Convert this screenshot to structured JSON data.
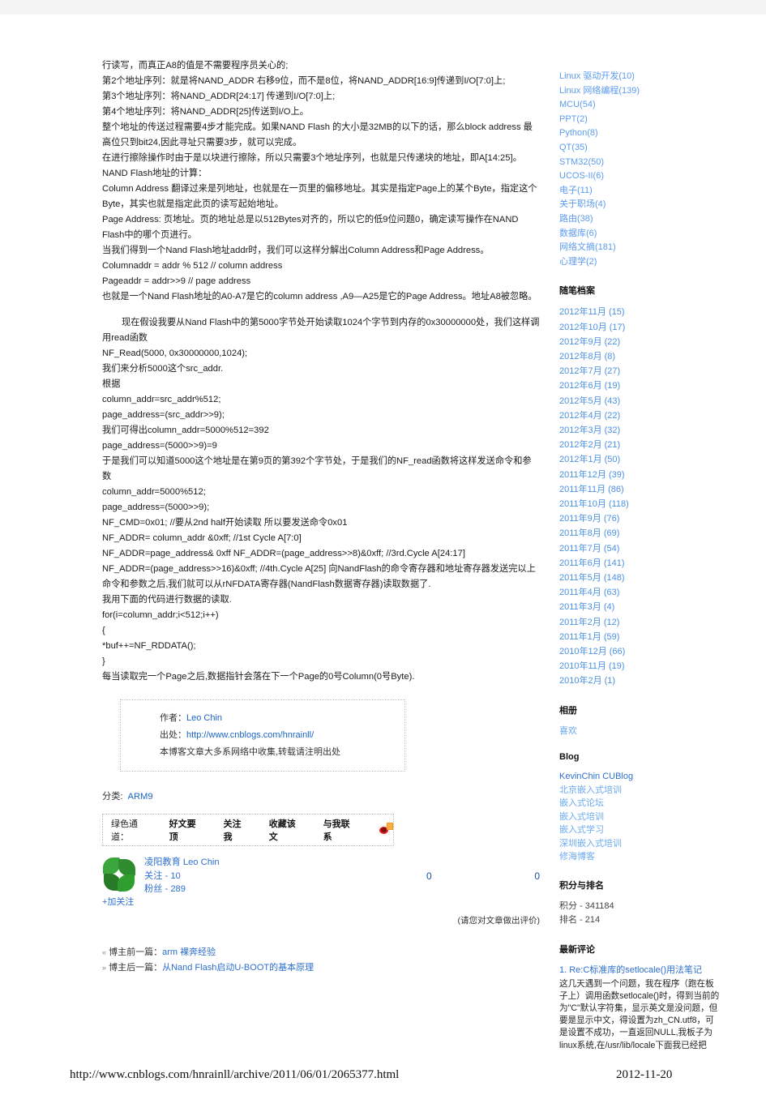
{
  "article": {
    "paragraphs": [
      "行读写，而真正A8的值是不需要程序员关心的;",
      "第2个地址序列：就是将NAND_ADDR 右移9位，而不是8位，将NAND_ADDR[16:9]传递到I/O[7:0]上;",
      "第3个地址序列：将NAND_ADDR[24:17] 传递到I/O[7:0]上;",
      "第4个地址序列：将NAND_ADDR[25]传送到I/O上。",
      "整个地址的传送过程需要4步才能完成。如果NAND Flash 的大小是32MB的以下的话，那么block address 最高位只到bit24,因此寻址只需要3步，就可以完成。",
      "在进行擦除操作时由于是以块进行擦除，所以只需要3个地址序列，也就是只传递块的地址，即A[14:25]。",
      "NAND Flash地址的计算：",
      "Column Address 翻译过来是列地址，也就是在一页里的偏移地址。其实是指定Page上的某个Byte，指定这个Byte，其实也就是指定此页的读写起始地址。",
      "Page Address: 页地址。页的地址总是以512Bytes对齐的，所以它的低9位问题0，确定读写操作在NAND Flash中的哪个页进行。",
      "当我们得到一个Nand Flash地址addr时，我们可以这样分解出Column Address和Page Address。",
      "Columnaddr = addr % 512 // column address",
      "Pageaddr = addr>>9 // page address",
      "也就是一个Nand Flash地址的A0-A7是它的column address ,A9—A25是它的Page Address。地址A8被忽略。"
    ],
    "paragraphs2": [
      "现在假设我要从Nand Flash中的第5000字节处开始读取1024个字节到内存的0x30000000处，我们这样调用read函数",
      "NF_Read(5000, 0x30000000,1024);",
      "我们来分析5000这个src_addr.",
      "根据",
      "column_addr=src_addr%512;",
      "page_address=(src_addr>>9);",
      "我们可得出column_addr=5000%512=392",
      "page_address=(5000>>9)=9",
      "于是我们可以知道5000这个地址是在第9页的第392个字节处，于是我们的NF_read函数将这样发送命令和参数",
      "column_addr=5000%512;",
      "page_address=(5000>>9);",
      "NF_CMD=0x01; //要从2nd half开始读取 所以要发送命令0x01",
      "NF_ADDR= column_addr &0xff; //1st Cycle A[7:0]",
      "NF_ADDR=page_address& 0xff NF_ADDR=(page_address>>8)&0xff; //3rd.Cycle A[24:17]",
      "NF_ADDR=(page_address>>16)&0xff; //4th.Cycle A[25] 向NandFlash的命令寄存器和地址寄存器发送完以上命令和参数之后,我们就可以从rNFDATA寄存器(NandFlash数据寄存器)读取数据了.",
      "我用下面的代码进行数据的读取.",
      "for(i=column_addr;i<512;i++)",
      "{",
      "*buf++=NF_RDDATA();",
      "}",
      "每当读取完一个Page之后,数据指针会落在下一个Page的0号Column(0号Byte)."
    ]
  },
  "author_box": {
    "author_label": "作者：",
    "author_name": "Leo Chin",
    "source_label": "出处：",
    "source_url": "http://www.cnblogs.com/hnrainll/",
    "notice": "本博客文章大多系网络中收集,转载请注明出处"
  },
  "categories": {
    "label": "分类:",
    "value": "ARM9"
  },
  "green_channel": {
    "label": "绿色通道：",
    "links": [
      "好文要顶",
      "关注我",
      "收藏该文",
      "与我联系"
    ],
    "icon": "weibo-icon"
  },
  "follow": {
    "name": "凌阳教育 Leo Chin",
    "following_label": "关注 - 10",
    "fans_label": "粉丝 - 289",
    "add_follow": "+加关注",
    "counter_left": "0",
    "counter_right": "0",
    "rate_note": "(请您对文章做出评价)"
  },
  "nav": {
    "prev_label": "博主前一篇：",
    "prev_link": "arm 裸奔经验",
    "next_label": "博主后一篇：",
    "next_link": "从Nand Flash启动U-BOOT的基本原理"
  },
  "sidebar": {
    "categories": [
      "Linux 驱动开发(10)",
      "Linux 网络编程(139)",
      "MCU(54)",
      "PPT(2)",
      "Python(8)",
      "QT(35)",
      "STM32(50)",
      "UCOS-II(6)",
      "电子(11)",
      "关于职场(4)",
      "路由(38)",
      "数据库(6)",
      "网络文摘(181)",
      "心理学(2)"
    ],
    "archive_title": "随笔档案",
    "archives": [
      "2012年11月 (15)",
      "2012年10月 (17)",
      "2012年9月 (22)",
      "2012年8月 (8)",
      "2012年7月 (27)",
      "2012年6月 (19)",
      "2012年5月 (43)",
      "2012年4月 (22)",
      "2012年3月 (32)",
      "2012年2月 (21)",
      "2012年1月 (50)",
      "2011年12月 (39)",
      "2011年11月 (86)",
      "2011年10月 (118)",
      "2011年9月 (76)",
      "2011年8月 (69)",
      "2011年7月 (54)",
      "2011年6月 (141)",
      "2011年5月 (148)",
      "2011年4月 (63)",
      "2011年3月 (4)",
      "2011年2月 (12)",
      "2011年1月 (59)",
      "2010年12月 (66)",
      "2010年11月 (19)",
      "2010年2月 (1)"
    ],
    "album_title": "相册",
    "album_items": [
      "喜欢"
    ],
    "blog_title": "Blog",
    "blog_links": [
      "KevinChin CUBlog",
      "北京嵌入式培训",
      "嵌入式论坛",
      "嵌入式培训",
      "嵌入式学习",
      "深圳嵌入式培训",
      "修海博客"
    ],
    "score_title": "积分与排名",
    "score_items": [
      "积分 - 341184",
      "排名 - 214"
    ],
    "comments_title": "最新评论",
    "comment": {
      "title": "1. Re:C标准库的setlocale()用法笔记",
      "body": "这几天遇到一个问题，我在程序（跑在板子上）调用函数setlocale()时，得到当前的为\"C\"默认字符集，显示英文是没问题，但要是显示中文，得设置为zh_CN.utf8，可是设置不成功，一直返回NULL,我板子为linux系统,在/usr/lib/locale下面我已经把"
    }
  },
  "footer": {
    "url": "http://www.cnblogs.com/hnrainll/archive/2011/06/01/2065377.html",
    "date": "2012-11-20"
  },
  "colors": {
    "link": "#2d6fd0",
    "sidebar_link": "#5b9bef",
    "topbar": "#f3f3f3"
  }
}
